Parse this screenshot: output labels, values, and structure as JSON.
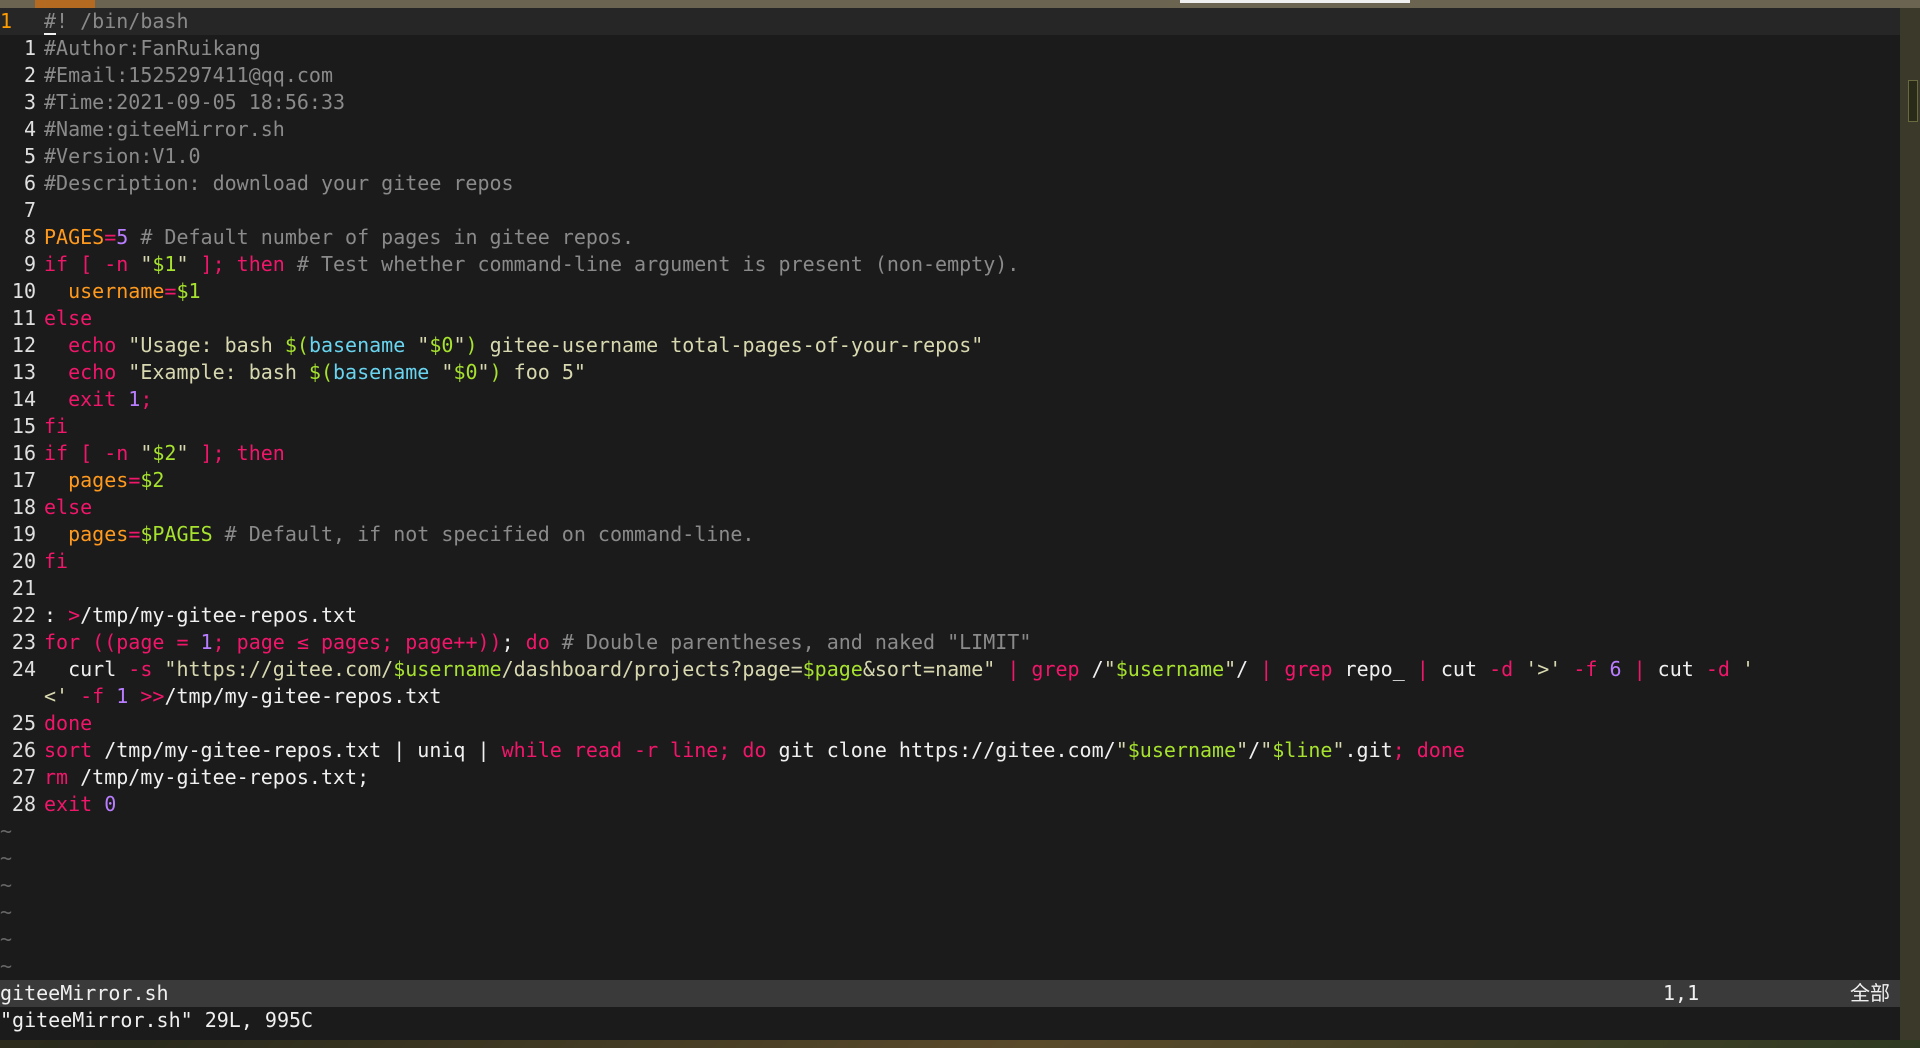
{
  "status": {
    "file": "giteeMirror.sh",
    "position": "1,1",
    "scope": "全部"
  },
  "cmdline": "\"giteeMirror.sh\" 29L, 995C",
  "colors": {
    "comment": "#8a8a8a",
    "keyword": "#f0166a",
    "variable": "#ff9a1e",
    "string": "#d8d8b0",
    "number": "#b97dff",
    "special_var": "#a6e22e",
    "command": "#68d4ef",
    "plain": "#f0f0f0"
  },
  "lines": [
    {
      "n": "1",
      "cur": true,
      "segs": [
        [
          "comment",
          "#! /bin/bash"
        ]
      ]
    },
    {
      "n": "1",
      "segs": [
        [
          "comment",
          "#Author:FanRuikang"
        ]
      ]
    },
    {
      "n": "2",
      "segs": [
        [
          "comment",
          "#Email:1525297411@qq.com"
        ]
      ]
    },
    {
      "n": "3",
      "segs": [
        [
          "comment",
          "#Time:2021-09-05 18:56:33"
        ]
      ]
    },
    {
      "n": "4",
      "segs": [
        [
          "comment",
          "#Name:giteeMirror.sh"
        ]
      ]
    },
    {
      "n": "5",
      "segs": [
        [
          "comment",
          "#Version:V1.0"
        ]
      ]
    },
    {
      "n": "6",
      "segs": [
        [
          "comment",
          "#Description: download your gitee repos"
        ]
      ]
    },
    {
      "n": "7",
      "segs": []
    },
    {
      "n": "8",
      "segs": [
        [
          "var",
          "PAGES"
        ],
        [
          "kw",
          "="
        ],
        [
          "num",
          "5"
        ],
        [
          "comment",
          " # Default number of pages in gitee repos."
        ]
      ]
    },
    {
      "n": "9",
      "segs": [
        [
          "kw",
          "if [ -n "
        ],
        [
          "str",
          "\""
        ],
        [
          "sv",
          "$1"
        ],
        [
          "str",
          "\""
        ],
        [
          "kw",
          " ]; then"
        ],
        [
          "comment",
          " # Test whether command-line argument is present (non-empty)."
        ]
      ]
    },
    {
      "n": "10",
      "segs": [
        [
          "plain",
          "  "
        ],
        [
          "var",
          "username"
        ],
        [
          "kw",
          "="
        ],
        [
          "sv",
          "$1"
        ]
      ]
    },
    {
      "n": "11",
      "segs": [
        [
          "kw",
          "else"
        ]
      ]
    },
    {
      "n": "12",
      "segs": [
        [
          "plain",
          "  "
        ],
        [
          "kw",
          "echo"
        ],
        [
          "str",
          " \"Usage: bash "
        ],
        [
          "sv",
          "$("
        ],
        [
          "cmd",
          "basename"
        ],
        [
          "str",
          " \""
        ],
        [
          "sv",
          "$0"
        ],
        [
          "str",
          "\""
        ],
        [
          "sv",
          ")"
        ],
        [
          "str",
          " gitee-username total-pages-of-your-repos\""
        ]
      ]
    },
    {
      "n": "13",
      "segs": [
        [
          "plain",
          "  "
        ],
        [
          "kw",
          "echo"
        ],
        [
          "str",
          " \"Example: bash "
        ],
        [
          "sv",
          "$("
        ],
        [
          "cmd",
          "basename"
        ],
        [
          "str",
          " \""
        ],
        [
          "sv",
          "$0"
        ],
        [
          "str",
          "\""
        ],
        [
          "sv",
          ")"
        ],
        [
          "str",
          " foo 5\""
        ]
      ]
    },
    {
      "n": "14",
      "segs": [
        [
          "plain",
          "  "
        ],
        [
          "kw",
          "exit"
        ],
        [
          "num",
          " 1"
        ],
        [
          "kw",
          ";"
        ]
      ]
    },
    {
      "n": "15",
      "segs": [
        [
          "kw",
          "fi"
        ]
      ]
    },
    {
      "n": "16",
      "segs": [
        [
          "kw",
          "if [ -n "
        ],
        [
          "str",
          "\""
        ],
        [
          "sv",
          "$2"
        ],
        [
          "str",
          "\""
        ],
        [
          "kw",
          " ]; then"
        ]
      ]
    },
    {
      "n": "17",
      "segs": [
        [
          "plain",
          "  "
        ],
        [
          "var",
          "pages"
        ],
        [
          "kw",
          "="
        ],
        [
          "sv",
          "$2"
        ]
      ]
    },
    {
      "n": "18",
      "segs": [
        [
          "kw",
          "else"
        ]
      ]
    },
    {
      "n": "19",
      "segs": [
        [
          "plain",
          "  "
        ],
        [
          "var",
          "pages"
        ],
        [
          "kw",
          "="
        ],
        [
          "sv",
          "$PAGES"
        ],
        [
          "comment",
          " # Default, if not specified on command-line."
        ]
      ]
    },
    {
      "n": "20",
      "segs": [
        [
          "kw",
          "fi"
        ]
      ]
    },
    {
      "n": "21",
      "segs": []
    },
    {
      "n": "22",
      "segs": [
        [
          "plain",
          ": "
        ],
        [
          "kw",
          ">"
        ],
        [
          "plain",
          "/tmp/my-gitee-repos.txt"
        ]
      ]
    },
    {
      "n": "23",
      "segs": [
        [
          "kw",
          "for (("
        ],
        [
          "kw",
          "page = "
        ],
        [
          "num",
          "1"
        ],
        [
          "kw",
          "; page ≤ pages; page++))"
        ],
        [
          "plain",
          ";"
        ],
        [
          "kw",
          " do"
        ],
        [
          "comment",
          " # Double parentheses, and naked \"LIMIT\""
        ]
      ]
    },
    {
      "n": "24",
      "segs": [
        [
          "plain",
          "  curl "
        ],
        [
          "kw",
          "-s"
        ],
        [
          "str",
          " \"https://gitee.com/"
        ],
        [
          "sv",
          "$username"
        ],
        [
          "str",
          "/dashboard/projects?page="
        ],
        [
          "sv",
          "$page"
        ],
        [
          "str",
          "&sort=name\""
        ],
        [
          "kw",
          " | "
        ],
        [
          "kw",
          "grep"
        ],
        [
          "plain",
          " /"
        ],
        [
          "str",
          "\""
        ],
        [
          "sv",
          "$username"
        ],
        [
          "str",
          "\""
        ],
        [
          "plain",
          "/"
        ],
        [
          "kw",
          " | "
        ],
        [
          "kw",
          "grep"
        ],
        [
          "plain",
          " repo_ "
        ],
        [
          "kw",
          "|"
        ],
        [
          "plain",
          " cut "
        ],
        [
          "kw",
          "-d"
        ],
        [
          "str",
          " '>'"
        ],
        [
          "kw",
          " -f"
        ],
        [
          "num",
          " 6"
        ],
        [
          "kw",
          " | "
        ],
        [
          "plain",
          "cut "
        ],
        [
          "kw",
          "-d"
        ],
        [
          "str",
          " '"
        ]
      ]
    },
    {
      "n": "",
      "wrap": true,
      "segs": [
        [
          "str",
          "<'"
        ],
        [
          "kw",
          " -f"
        ],
        [
          "num",
          " 1"
        ],
        [
          "kw",
          " >>"
        ],
        [
          "plain",
          "/tmp/my-gitee-repos.txt"
        ]
      ]
    },
    {
      "n": "25",
      "segs": [
        [
          "kw",
          "done"
        ]
      ]
    },
    {
      "n": "26",
      "segs": [
        [
          "kw",
          "sort"
        ],
        [
          "plain",
          " /tmp/my-gitee-repos.txt | uniq | "
        ],
        [
          "kw",
          "while read -r line; do"
        ],
        [
          "plain",
          " git clone https://gitee.com/"
        ],
        [
          "str",
          "\""
        ],
        [
          "sv",
          "$username"
        ],
        [
          "str",
          "\""
        ],
        [
          "plain",
          "/"
        ],
        [
          "str",
          "\""
        ],
        [
          "sv",
          "$line"
        ],
        [
          "str",
          "\""
        ],
        [
          "plain",
          ".git"
        ],
        [
          "kw",
          "; done"
        ]
      ]
    },
    {
      "n": "27",
      "segs": [
        [
          "kw",
          "rm"
        ],
        [
          "plain",
          " /tmp/my-gitee-repos.txt;"
        ]
      ]
    },
    {
      "n": "28",
      "segs": [
        [
          "kw",
          "exit"
        ],
        [
          "num",
          " 0"
        ]
      ]
    }
  ],
  "tildes": [
    "~",
    "~",
    "~",
    "~",
    "~",
    "~"
  ]
}
